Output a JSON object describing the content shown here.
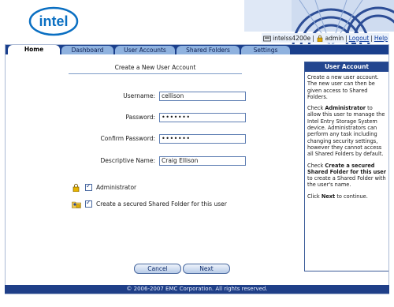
{
  "header": {
    "logo_text": "intel",
    "user": {
      "device_name": "intelss4200e",
      "username": "admin",
      "logout_label": "Logout",
      "help_label": "Help",
      "separator": "|"
    }
  },
  "tabs": [
    {
      "label": "Home",
      "active": true
    },
    {
      "label": "Dashboard",
      "active": false
    },
    {
      "label": "User Accounts",
      "active": false
    },
    {
      "label": "Shared Folders",
      "active": false
    },
    {
      "label": "Settings",
      "active": false
    }
  ],
  "form": {
    "title": "Create a New User Account",
    "fields": [
      {
        "label": "Username:",
        "value": "cellison",
        "type": "text"
      },
      {
        "label": "Password:",
        "value": "•••••••",
        "type": "password"
      },
      {
        "label": "Confirm Password:",
        "value": "•••••••",
        "type": "password"
      },
      {
        "label": "Descriptive Name:",
        "value": "Craig Ellison",
        "type": "text"
      }
    ],
    "options": [
      {
        "label": "Administrator",
        "checked": true,
        "icon": "user-lock-icon"
      },
      {
        "label": "Create a secured Shared Folder for this user",
        "checked": true,
        "icon": "folder-user-icon"
      }
    ],
    "cancel_label": "Cancel",
    "next_label": "Next"
  },
  "side_panel": {
    "title": "User Account",
    "paragraphs": [
      {
        "pre": "Create a new user account. The new user can then be given access to Shared Folders.",
        "bold": "",
        "post": ""
      },
      {
        "pre": "Check ",
        "bold": "Administrator",
        "post": " to allow this user to manage the Intel Entry Storage System device. Administrators can perform any task including changing security settings, however they cannot access all Shared Folders by default."
      },
      {
        "pre": "Check ",
        "bold": "Create a secured Shared Folder for this user",
        "post": " to create a Shared Folder with the user's name."
      },
      {
        "pre": "Click ",
        "bold": "Next",
        "post": " to continue."
      }
    ]
  },
  "footer": {
    "copyright": "© 2006-2007 EMC Corporation. All rights reserved."
  },
  "colors": {
    "brand_blue": "#1a3f8c",
    "tab_inactive": "#8fb2df",
    "panel_header": "#23468f",
    "intel_blue": "#0a6fc2"
  }
}
